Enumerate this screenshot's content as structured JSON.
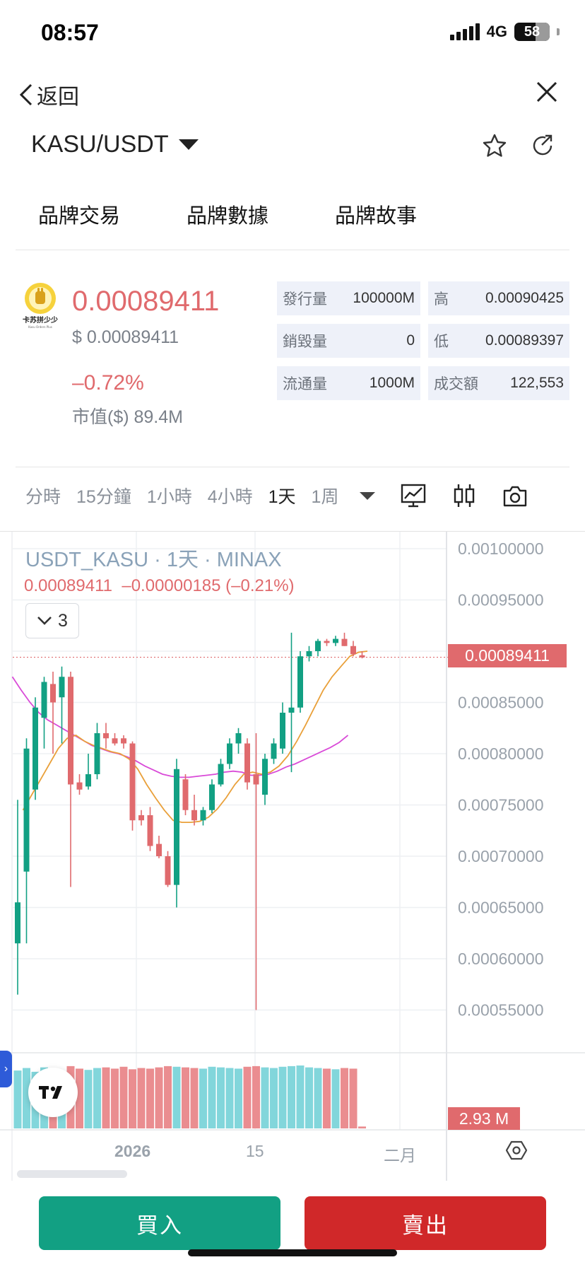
{
  "status_bar": {
    "time": "08:57",
    "network": "4G",
    "battery": "58"
  },
  "nav": {
    "back_label": "返回",
    "pair": "KASU/USDT"
  },
  "tabs": [
    {
      "label": "品牌交易"
    },
    {
      "label": "品牌數據"
    },
    {
      "label": "品牌故事"
    }
  ],
  "token": {
    "logo_text": "卡苏拼少少",
    "price": "0.00089411",
    "price_usd": "$ 0.00089411",
    "change": "–0.72%",
    "market_cap": "市值($) 89.4M",
    "up_color": "#12a083",
    "down_color": "#e06a6d"
  },
  "stats": [
    {
      "label": "發行量",
      "value": "100000M"
    },
    {
      "label": "高",
      "value": "0.00090425"
    },
    {
      "label": "銷毀量",
      "value": "0"
    },
    {
      "label": "低",
      "value": "0.00089397"
    },
    {
      "label": "流通量",
      "value": "1000M"
    },
    {
      "label": "成交額",
      "value": "122,553"
    }
  ],
  "timeframes": [
    {
      "label": "分時",
      "active": false
    },
    {
      "label": "15分鐘",
      "active": false
    },
    {
      "label": "1小時",
      "active": false
    },
    {
      "label": "4小時",
      "active": false
    },
    {
      "label": "1天",
      "active": true
    },
    {
      "label": "1周",
      "active": false
    }
  ],
  "chart_header": {
    "title": "USDT_KASU · 1天 · MINAX",
    "ohlc_line": "0.00089411  –0.00000185 (–0.21%)",
    "collapse_count": "3"
  },
  "chart_data": {
    "type": "candlestick",
    "price_axis_ticks": [
      "0.00100000",
      "0.00095000",
      "0.00090000",
      "0.00085000",
      "0.00080000",
      "0.00075000",
      "0.00070000",
      "0.00065000",
      "0.00060000",
      "0.00055000"
    ],
    "y_range": [
      0.00051,
      0.00101
    ],
    "last_price": "0.00089411",
    "volume_label": "2.93 M",
    "x_axis_labels": [
      {
        "label": "2026",
        "bold": true
      },
      {
        "label": "15",
        "bold": false
      },
      {
        "label": "二月",
        "bold": false
      }
    ],
    "candles": [
      {
        "o": 0.000615,
        "h": 0.000755,
        "l": 0.000565,
        "c": 0.000655
      },
      {
        "o": 0.000685,
        "h": 0.000815,
        "l": 0.000615,
        "c": 0.000805
      },
      {
        "o": 0.000765,
        "h": 0.000855,
        "l": 0.000755,
        "c": 0.000845
      },
      {
        "o": 0.000835,
        "h": 0.000875,
        "l": 0.000805,
        "c": 0.00087
      },
      {
        "o": 0.000868,
        "h": 0.00088,
        "l": 0.0008,
        "c": 0.00085
      },
      {
        "o": 0.000855,
        "h": 0.000885,
        "l": 0.00081,
        "c": 0.000875
      },
      {
        "o": 0.000875,
        "h": 0.00088,
        "l": 0.00067,
        "c": 0.00077
      },
      {
        "o": 0.000772,
        "h": 0.00078,
        "l": 0.00076,
        "c": 0.000765
      },
      {
        "o": 0.000768,
        "h": 0.0008,
        "l": 0.000765,
        "c": 0.00078
      },
      {
        "o": 0.00078,
        "h": 0.00083,
        "l": 0.000775,
        "c": 0.00082
      },
      {
        "o": 0.00082,
        "h": 0.00083,
        "l": 0.000805,
        "c": 0.000815
      },
      {
        "o": 0.000815,
        "h": 0.00082,
        "l": 0.000808,
        "c": 0.00081
      },
      {
        "o": 0.000815,
        "h": 0.000818,
        "l": 0.000805,
        "c": 0.00081
      },
      {
        "o": 0.00081,
        "h": 0.000812,
        "l": 0.000725,
        "c": 0.000735
      },
      {
        "o": 0.00074,
        "h": 0.000745,
        "l": 0.00073,
        "c": 0.000735
      },
      {
        "o": 0.00074,
        "h": 0.000748,
        "l": 0.000705,
        "c": 0.00071
      },
      {
        "o": 0.000712,
        "h": 0.00072,
        "l": 0.000698,
        "c": 0.0007
      },
      {
        "o": 0.0007,
        "h": 0.000705,
        "l": 0.00067,
        "c": 0.000672
      },
      {
        "o": 0.000672,
        "h": 0.000795,
        "l": 0.00065,
        "c": 0.000785
      },
      {
        "o": 0.000775,
        "h": 0.00078,
        "l": 0.00074,
        "c": 0.000745
      },
      {
        "o": 0.000745,
        "h": 0.00076,
        "l": 0.00073,
        "c": 0.000735
      },
      {
        "o": 0.000735,
        "h": 0.000748,
        "l": 0.00073,
        "c": 0.000745
      },
      {
        "o": 0.000745,
        "h": 0.000775,
        "l": 0.000742,
        "c": 0.00077
      },
      {
        "o": 0.00077,
        "h": 0.000795,
        "l": 0.000768,
        "c": 0.00079
      },
      {
        "o": 0.00079,
        "h": 0.000815,
        "l": 0.000785,
        "c": 0.00081
      },
      {
        "o": 0.00081,
        "h": 0.000825,
        "l": 0.0008,
        "c": 0.00082
      },
      {
        "o": 0.00081,
        "h": 0.000815,
        "l": 0.000765,
        "c": 0.000772
      },
      {
        "o": 0.00078,
        "h": 0.00082,
        "l": 0.00055,
        "c": 0.00077
      },
      {
        "o": 0.00076,
        "h": 0.0008,
        "l": 0.00075,
        "c": 0.000795
      },
      {
        "o": 0.000795,
        "h": 0.000815,
        "l": 0.00079,
        "c": 0.00081
      },
      {
        "o": 0.000805,
        "h": 0.00085,
        "l": 0.0008,
        "c": 0.00084
      },
      {
        "o": 0.00084,
        "h": 0.000918,
        "l": 0.000782,
        "c": 0.000845
      },
      {
        "o": 0.000845,
        "h": 0.0009,
        "l": 0.00084,
        "c": 0.000895
      },
      {
        "o": 0.000895,
        "h": 0.000905,
        "l": 0.00089,
        "c": 0.0009
      },
      {
        "o": 0.0009,
        "h": 0.000912,
        "l": 0.000895,
        "c": 0.00091
      },
      {
        "o": 0.00091,
        "h": 0.000912,
        "l": 0.000905,
        "c": 0.000908
      },
      {
        "o": 0.000908,
        "h": 0.000915,
        "l": 0.000905,
        "c": 0.000912
      },
      {
        "o": 0.000912,
        "h": 0.000918,
        "l": 0.000905,
        "c": 0.000905
      },
      {
        "o": 0.000905,
        "h": 0.00091,
        "l": 0.000895,
        "c": 0.000897
      },
      {
        "o": 0.000896,
        "h": 0.0009,
        "l": 0.000893,
        "c": 0.000894
      }
    ],
    "ma_fast": [
      0.000745,
      0.00076,
      0.000775,
      0.00079,
      0.000805,
      0.000815,
      0.000818,
      0.000812,
      0.000808,
      0.000805,
      0.000802,
      0.0008,
      0.000795,
      0.000785,
      0.00077,
      0.000757,
      0.000745,
      0.000735,
      0.000733,
      0.000733,
      0.000734,
      0.000738,
      0.000746,
      0.000757,
      0.00077,
      0.00078,
      0.000782,
      0.00078,
      0.000782,
      0.000788,
      0.000798,
      0.000812,
      0.000828,
      0.000845,
      0.000862,
      0.000875,
      0.000885,
      0.000895,
      0.000899,
      0.0009
    ],
    "ma_slow": [
      0.000875,
      0.000862,
      0.00085,
      0.00084,
      0.000833,
      0.000828,
      0.000823,
      0.000818,
      0.000813,
      0.000808,
      0.000805,
      0.000802,
      0.0008,
      0.000797,
      0.000793,
      0.000788,
      0.000784,
      0.00078,
      0.000778,
      0.000777,
      0.000777,
      0.000778,
      0.000779,
      0.00078,
      0.000782,
      0.000783,
      0.000782,
      0.000779,
      0.000779,
      0.00078,
      0.000783,
      0.000787,
      0.00079,
      0.000794,
      0.000798,
      0.000802,
      0.000806,
      0.000811,
      0.000818
    ],
    "volumes": [
      0.92,
      0.96,
      0.9,
      0.97,
      0.94,
      0.88,
      0.99,
      0.95,
      0.93,
      0.96,
      0.97,
      0.95,
      0.98,
      0.94,
      0.96,
      0.95,
      0.97,
      0.99,
      0.98,
      0.97,
      0.96,
      0.95,
      0.98,
      0.97,
      0.96,
      0.95,
      0.98,
      0.99,
      0.97,
      0.96,
      0.98,
      0.99,
      1.0,
      0.97,
      0.96,
      0.95,
      0.94,
      0.96,
      0.95,
      0.03
    ]
  },
  "buttons": {
    "buy": "買入",
    "sell": "賣出"
  }
}
